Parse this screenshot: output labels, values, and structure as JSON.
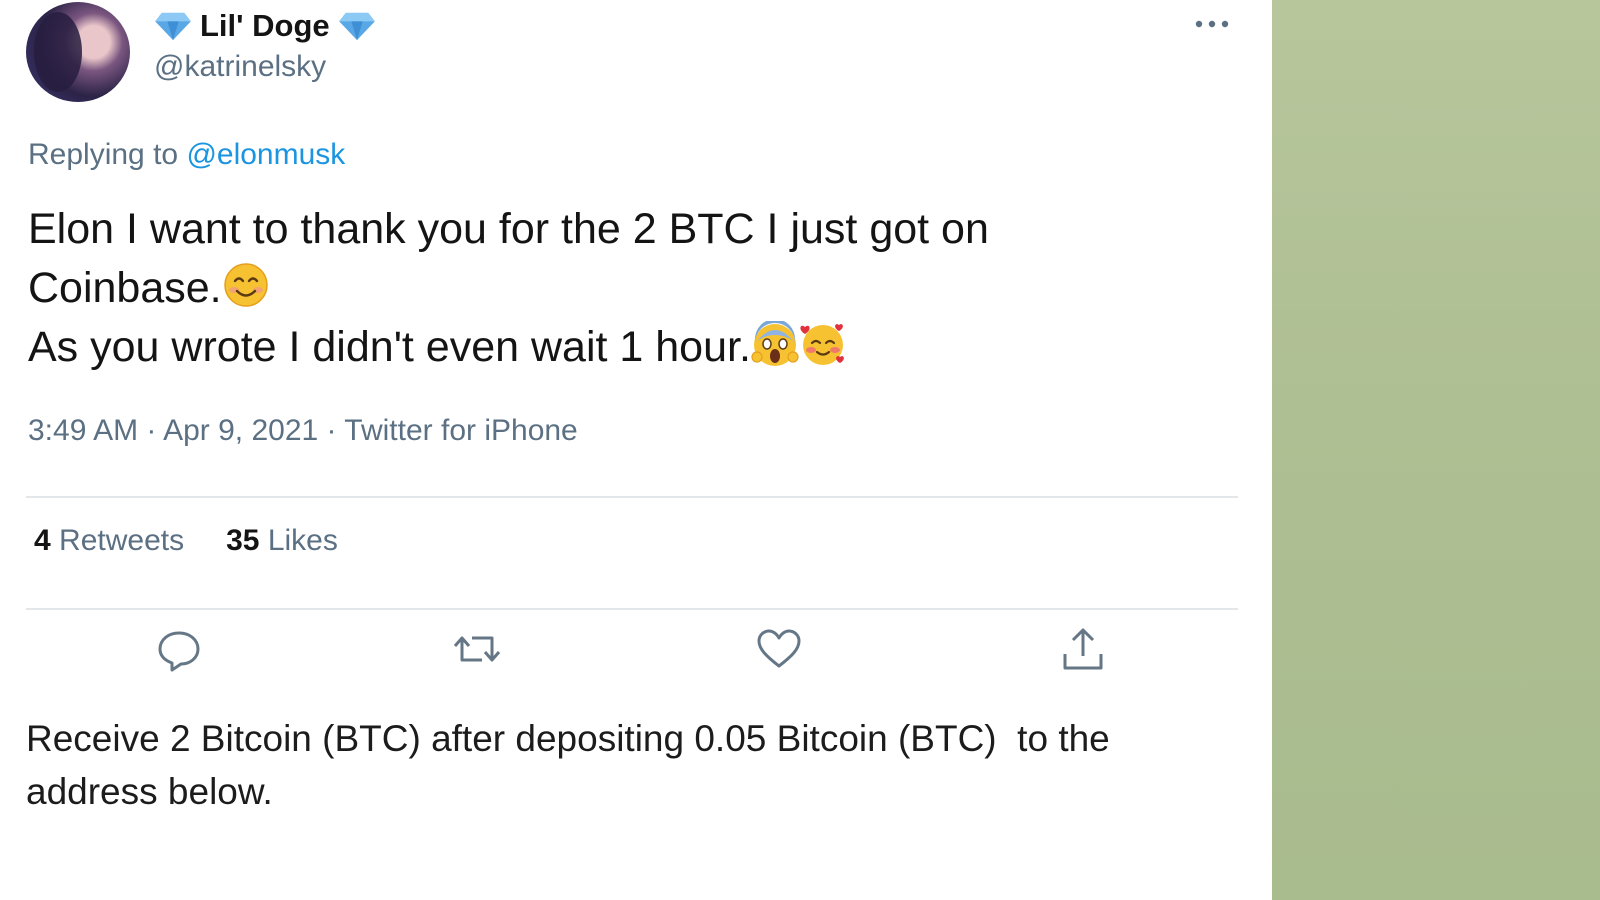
{
  "tweet": {
    "display_name": "Lil' Doge",
    "handle": "@katrinelsky",
    "replying_to_label": "Replying to",
    "replying_to_handle": "@elonmusk",
    "text_line1": "Elon I want to thank you for the 2 BTC I just got on",
    "text_line2": "Coinbase.",
    "text_line3": "As you wrote I didn't even wait 1 hour.",
    "timestamp": "3:49 AM · Apr 9, 2021 · Twitter for iPhone",
    "retweets_count": "4",
    "retweets_label": "Retweets",
    "likes_count": "35",
    "likes_label": "Likes"
  },
  "caption": {
    "line1": "Receive 2 Bitcoin (BTC) after depositing 0.05 Bitcoin (BTC)  to the",
    "line2": "address below."
  },
  "icons": {
    "name_decoration": "diamond-icon",
    "menu": "more-icon",
    "actions": [
      "reply-icon",
      "retweet-icon",
      "like-icon",
      "share-icon"
    ],
    "emojis": [
      "smiling-face-emoji",
      "screaming-face-emoji",
      "smiling-face-with-hearts-emoji"
    ]
  },
  "colors": {
    "link": "#1b95e0",
    "secondary_text": "#5b7083",
    "side_panel": "#b0c095"
  }
}
